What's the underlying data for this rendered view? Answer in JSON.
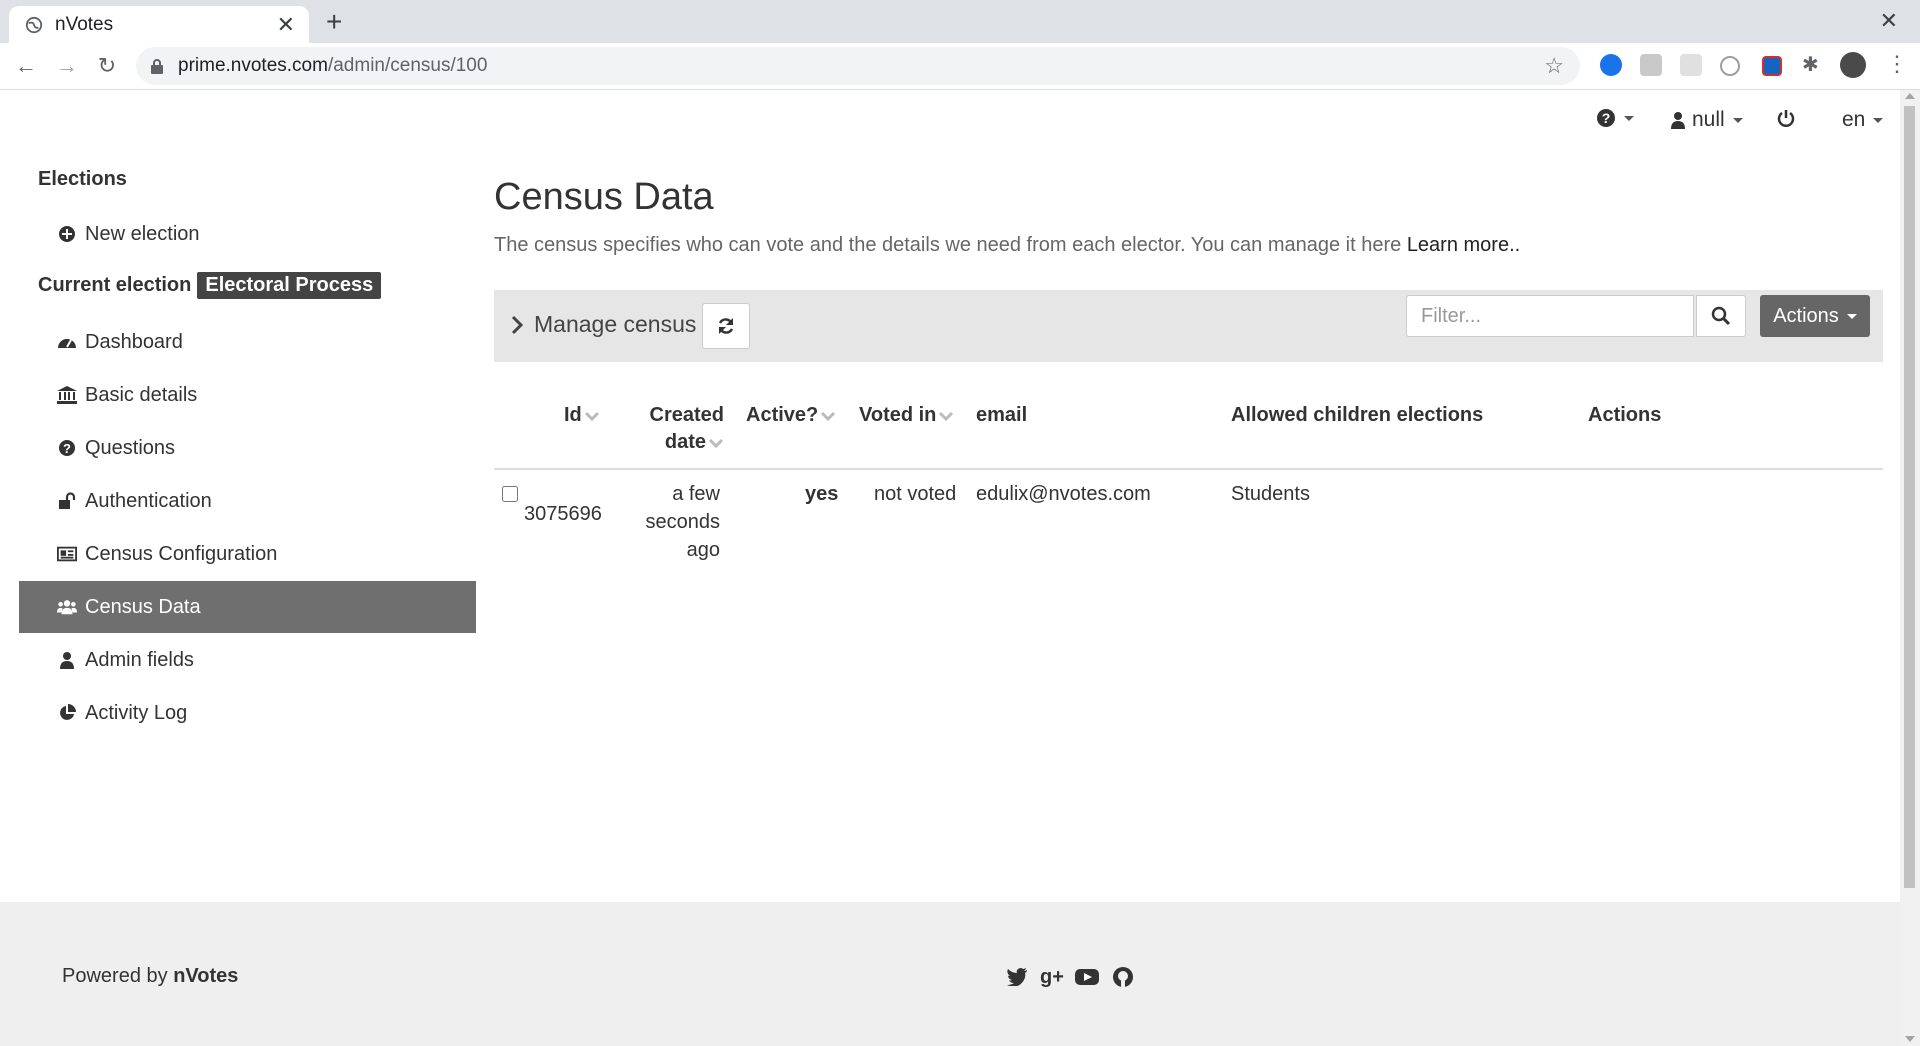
{
  "browser": {
    "tab_title": "nVotes",
    "url_domain": "prime.nvotes.com",
    "url_path": "/admin/census/100"
  },
  "topnav": {
    "user": "null",
    "lang": "en"
  },
  "sidebar": {
    "elections_heading": "Elections",
    "new_election": "New election",
    "current_election_label": "Current election",
    "current_election_badge": "Electoral Process",
    "items": [
      {
        "label": "Dashboard"
      },
      {
        "label": "Basic details"
      },
      {
        "label": "Questions"
      },
      {
        "label": "Authentication"
      },
      {
        "label": "Census Configuration"
      },
      {
        "label": "Census Data"
      },
      {
        "label": "Admin fields"
      },
      {
        "label": "Activity Log"
      }
    ]
  },
  "main": {
    "title": "Census Data",
    "description": "The census specifies who can vote and the details we need from each elector. You can manage it here",
    "learn_more": "Learn more..",
    "manage_census": "Manage census",
    "filter_placeholder": "Filter...",
    "actions_button": "Actions"
  },
  "table": {
    "headers": {
      "id": "Id",
      "created_line1": "Created",
      "created_line2": "date",
      "active": "Active?",
      "voted_in": "Voted in",
      "email": "email",
      "children": "Allowed children elections",
      "actions": "Actions"
    },
    "rows": [
      {
        "id": "3075696",
        "created_l1": "a few",
        "created_l2": "seconds",
        "created_l3": "ago",
        "active": "yes",
        "voted": "not voted",
        "email": "edulix@nvotes.com",
        "children": "Students"
      }
    ]
  },
  "footer": {
    "powered_by": "Powered by",
    "brand": "nVotes"
  },
  "colors": {
    "active_item_bg": "#6f6f6f",
    "badge_bg": "#444444",
    "actions_bg": "#666666",
    "footer_bg": "#efefef"
  }
}
